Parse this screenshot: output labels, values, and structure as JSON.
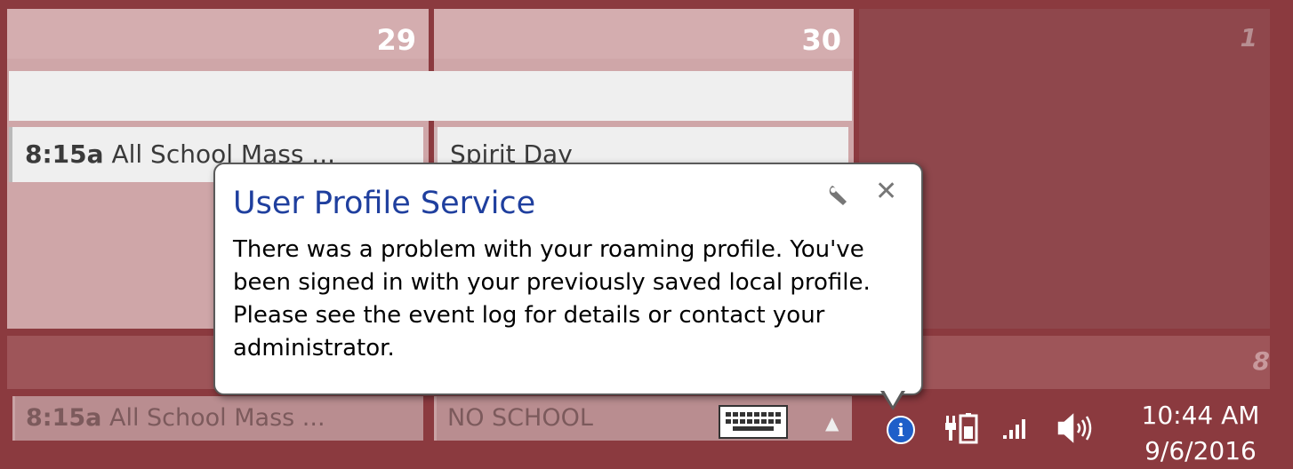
{
  "calendar": {
    "days": {
      "d29": "29",
      "d30": "30",
      "d1": "1",
      "d8": "8"
    },
    "events": {
      "ev29_time": "8:15a",
      "ev29_title": " All School Mass ...",
      "ev30_title": "Spirit Day"
    },
    "bottom_events": {
      "e1_time": "8:15a",
      "e1_title": " All School Mass ...",
      "e2_title": "NO SCHOOL"
    }
  },
  "notification": {
    "title": "User Profile Service",
    "body": "There was a problem with your roaming profile. You've been signed in with your previously saved local profile. Please see the event log for details or contact your administrator."
  },
  "taskbar": {
    "icons": [
      "keyboard-icon",
      "chevron-up-icon",
      "info-icon",
      "power-icon",
      "signal-icon",
      "volume-icon"
    ],
    "clock_time": "10:44 AM",
    "clock_date": "9/6/2016",
    "chevron": "▲",
    "info_glyph": "i"
  },
  "colors": {
    "background": "#8b3a3f",
    "title_blue": "#1f3f9e",
    "info_blue": "#1e5fc9"
  }
}
